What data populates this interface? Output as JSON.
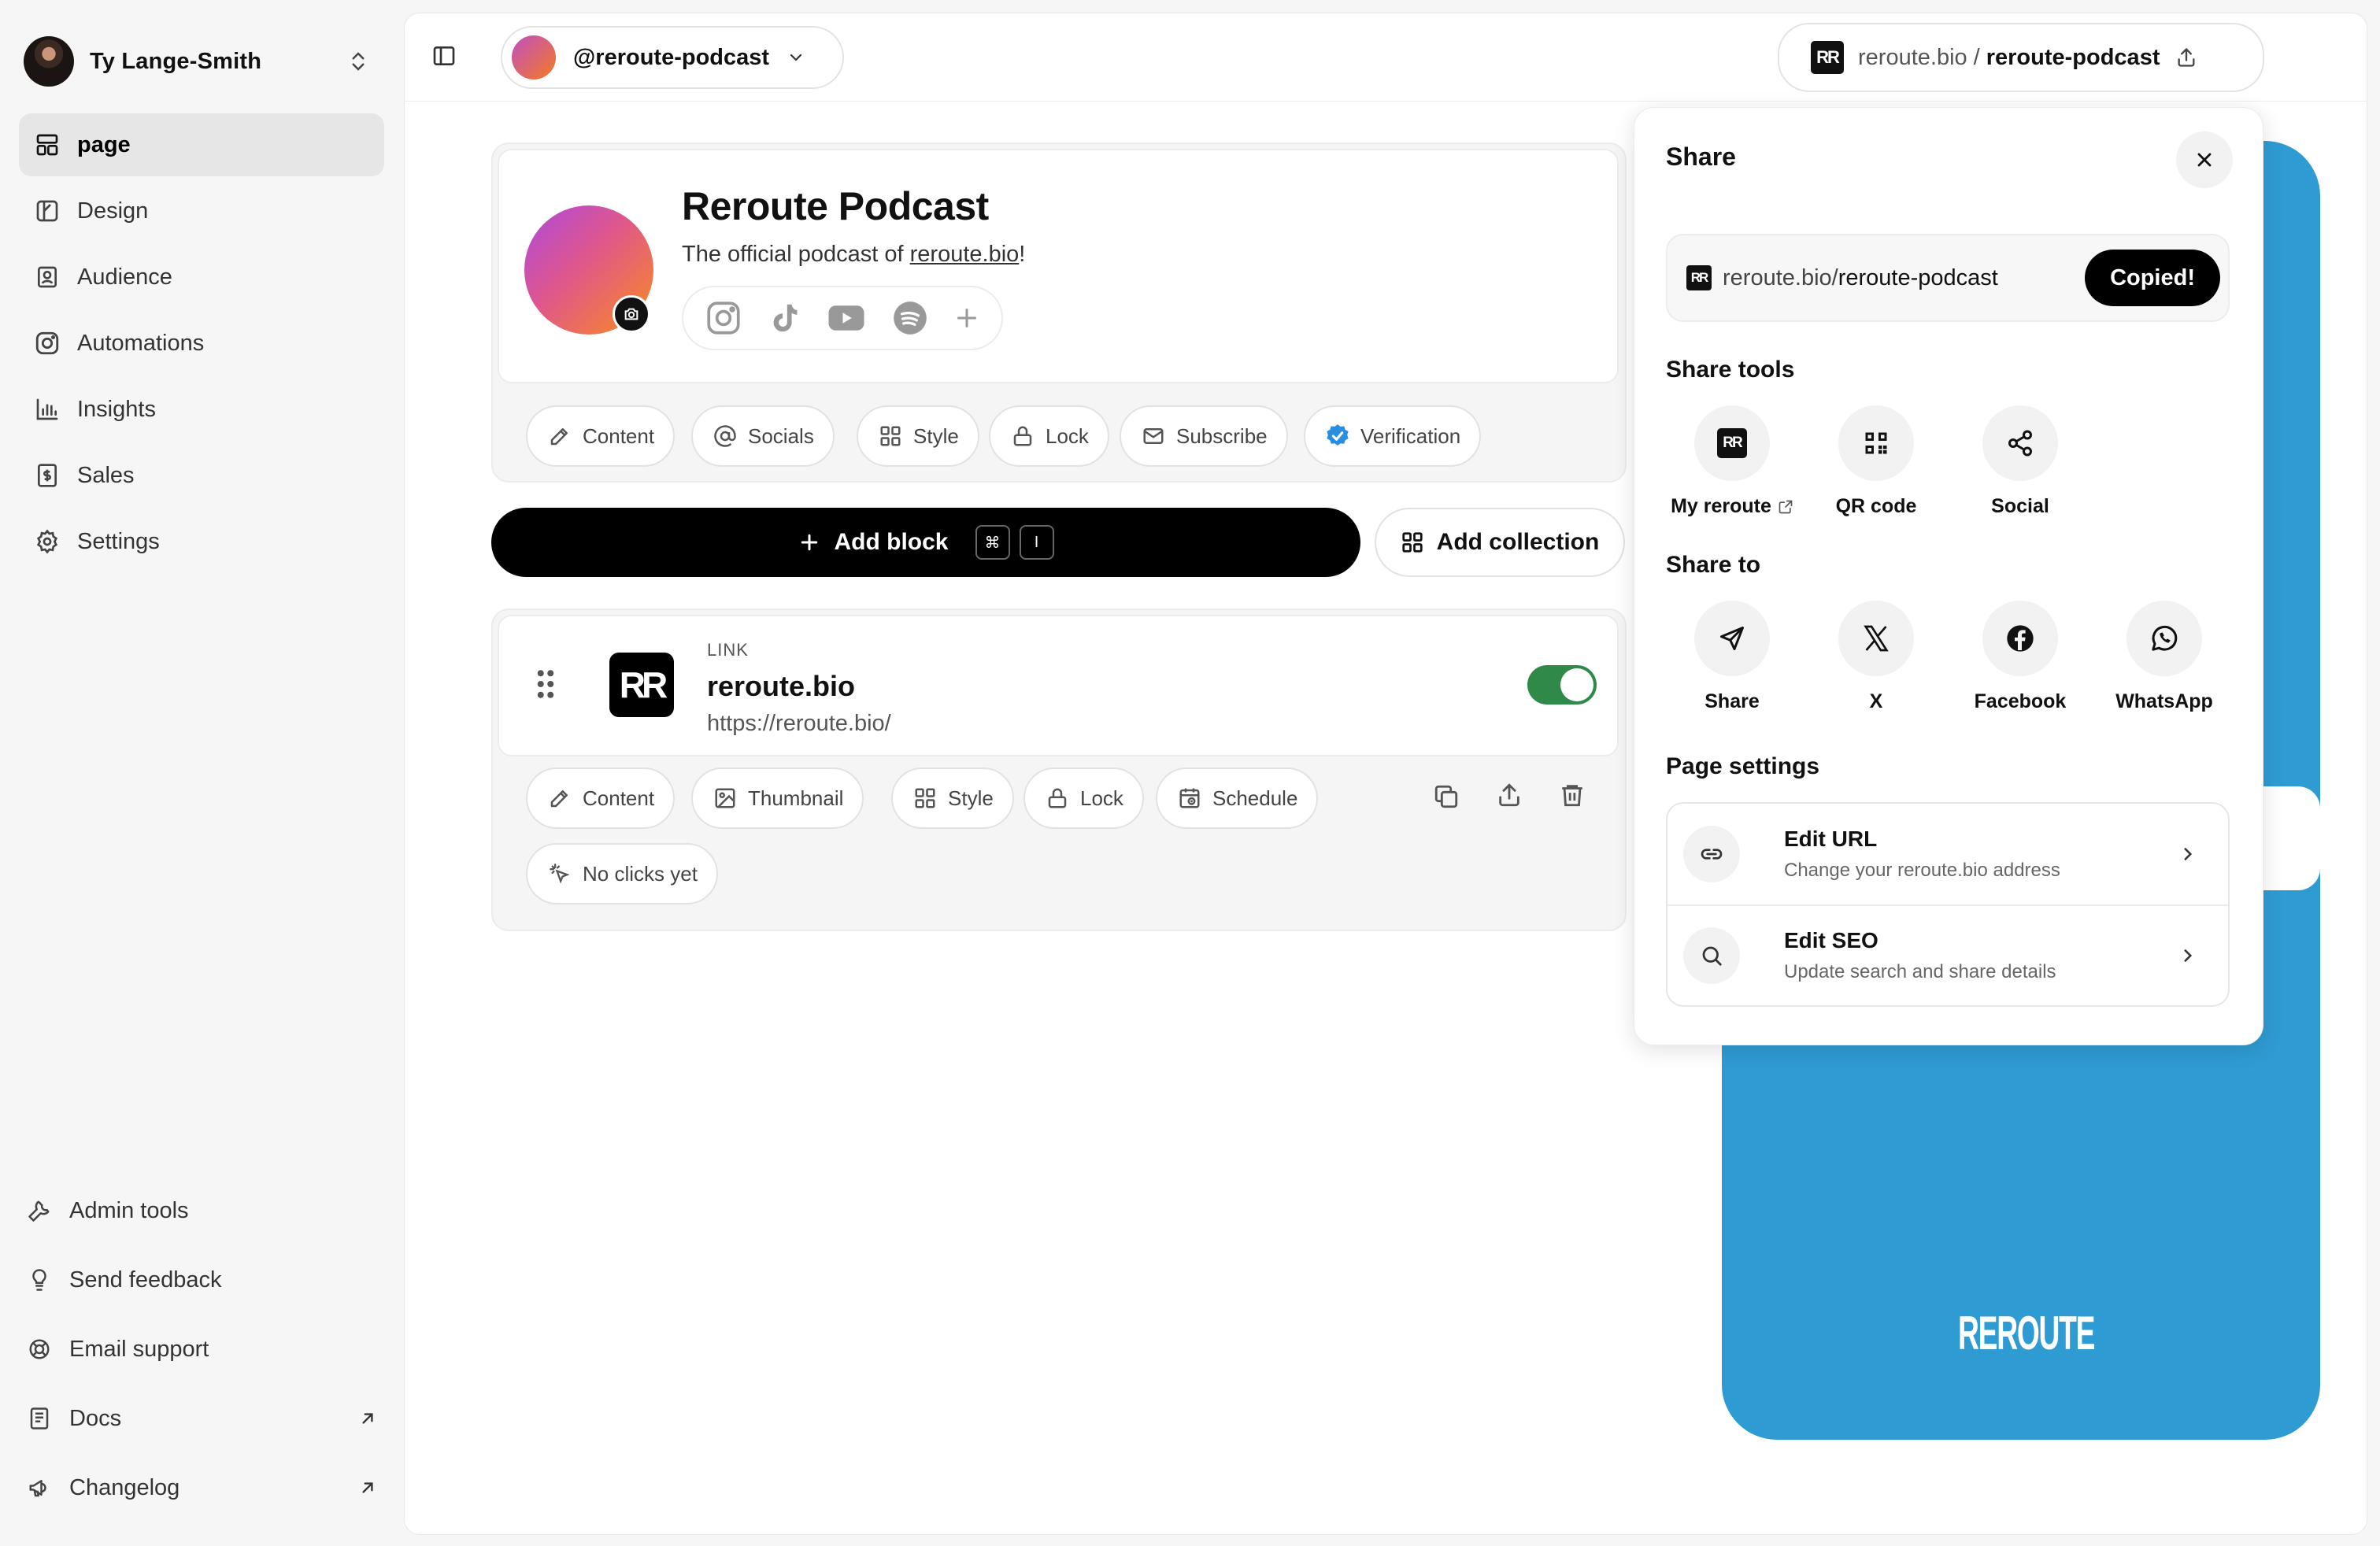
{
  "user": {
    "name": "Ty Lange-Smith"
  },
  "nav": [
    {
      "label": "page",
      "icon": "layout-icon",
      "active": true
    },
    {
      "label": "Design",
      "icon": "palette-icon"
    },
    {
      "label": "Audience",
      "icon": "contact-icon"
    },
    {
      "label": "Automations",
      "icon": "instagram-icon"
    },
    {
      "label": "Insights",
      "icon": "bar-chart-icon"
    },
    {
      "label": "Sales",
      "icon": "dollar-icon"
    },
    {
      "label": "Settings",
      "icon": "gear-icon"
    }
  ],
  "footer_nav": [
    {
      "label": "Admin tools",
      "icon": "wrench-icon"
    },
    {
      "label": "Send feedback",
      "icon": "lightbulb-icon"
    },
    {
      "label": "Email support",
      "icon": "lifebuoy-icon"
    },
    {
      "label": "Docs",
      "icon": "book-icon",
      "external": true
    },
    {
      "label": "Changelog",
      "icon": "megaphone-icon",
      "external": true
    }
  ],
  "topbar": {
    "page_handle": "@reroute-podcast",
    "url_domain": "reroute.bio",
    "url_sep": "/",
    "url_slug": "reroute-podcast"
  },
  "profile": {
    "title": "Reroute Podcast",
    "bio_prefix": "The official podcast of ",
    "bio_link": "reroute.bio",
    "bio_suffix": "!",
    "socials": [
      "instagram-icon",
      "tiktok-icon",
      "youtube-icon",
      "spotify-icon",
      "plus-icon"
    ],
    "chips": [
      "Content",
      "Socials",
      "Style",
      "Lock",
      "Subscribe",
      "Verification"
    ]
  },
  "actions": {
    "add_block": "Add block",
    "shortcut_keys": [
      "⌘",
      "I"
    ],
    "add_collection": "Add collection"
  },
  "block": {
    "type": "LINK",
    "title": "reroute.bio",
    "url": "https://reroute.bio/",
    "enabled": true,
    "chips": [
      "Content",
      "Thumbnail",
      "Style",
      "Lock",
      "Schedule"
    ],
    "stats": "No clicks yet"
  },
  "share": {
    "title": "Share",
    "link_domain": "reroute.bio",
    "link_sep": "/",
    "link_slug": "reroute-podcast",
    "copied_label": "Copied!",
    "tools_heading": "Share tools",
    "tools": [
      "My reroute",
      "QR code",
      "Social"
    ],
    "share_to_heading": "Share to",
    "share_to": [
      "Share",
      "X",
      "Facebook",
      "WhatsApp"
    ],
    "settings_heading": "Page settings",
    "settings": [
      {
        "title": "Edit URL",
        "desc": "Change your reroute.bio address"
      },
      {
        "title": "Edit SEO",
        "desc": "Update search and share details"
      }
    ]
  },
  "preview": {
    "brand": "REROUTE",
    "bg_color": "#2f9bd3"
  },
  "colors": {
    "toggle_on": "#2f8a4a",
    "verified": "#2a8ee0",
    "primary_button": "#000000"
  }
}
